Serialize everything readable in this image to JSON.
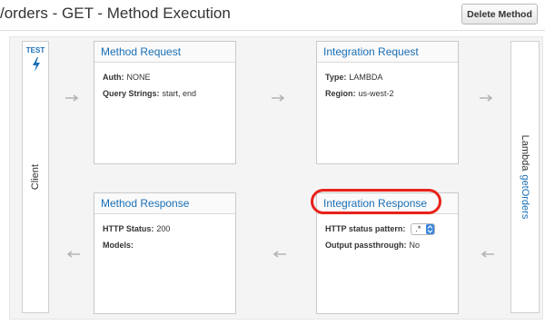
{
  "header": {
    "title": "/orders - GET - Method Execution",
    "delete_label": "Delete Method"
  },
  "client": {
    "test_label": "TEST",
    "label": "Client",
    "icon": "lightning-bolt-icon"
  },
  "lambda": {
    "label": "Lambda",
    "function_name": "getOrders"
  },
  "method_request": {
    "title": "Method Request",
    "auth_label": "Auth:",
    "auth_value": "NONE",
    "query_label": "Query Strings:",
    "query_value": "start, end"
  },
  "integration_request": {
    "title": "Integration Request",
    "type_label": "Type:",
    "type_value": "LAMBDA",
    "region_label": "Region:",
    "region_value": "us-west-2"
  },
  "method_response": {
    "title": "Method Response",
    "status_label": "HTTP Status:",
    "status_value": "200",
    "models_label": "Models:"
  },
  "integration_response": {
    "title": "Integration Response",
    "pattern_label": "HTTP status pattern:",
    "pattern_value": ".*",
    "passthrough_label": "Output passthrough:",
    "passthrough_value": "No"
  },
  "colors": {
    "link": "#1a6fb5",
    "highlight": "#e8221b",
    "arrow": "#b3b3b3"
  }
}
